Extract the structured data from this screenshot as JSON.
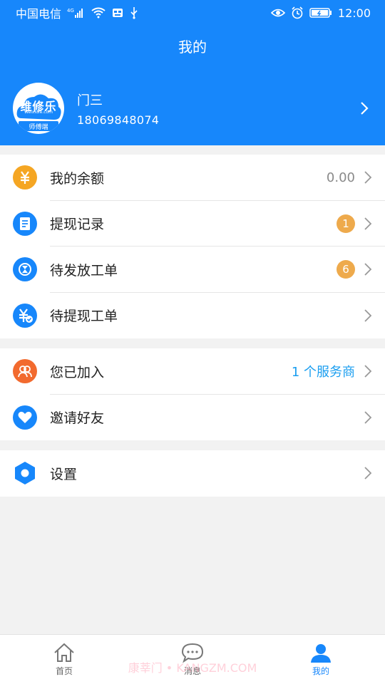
{
  "status_bar": {
    "carrier": "中国电信",
    "network": "4G",
    "time": "12:00"
  },
  "header": {
    "title": "我的"
  },
  "profile": {
    "name": "门三",
    "phone": "18069848074",
    "avatar_brand": "维修乐",
    "avatar_url": "Weixiule.com",
    "avatar_badge": "师傅端"
  },
  "menu_group_1": [
    {
      "label": "我的余额",
      "value": "0.00",
      "icon": "yen-icon",
      "color": "#f5a623"
    },
    {
      "label": "提现记录",
      "badge": "1",
      "icon": "document-icon",
      "color": "#1787fb"
    },
    {
      "label": "待发放工单",
      "badge": "6",
      "icon": "hourglass-icon",
      "color": "#1787fb"
    },
    {
      "label": "待提现工单",
      "icon": "yen-check-icon",
      "color": "#1787fb"
    }
  ],
  "menu_group_2": [
    {
      "label": "您已加入",
      "value": "1 个服务商",
      "icon": "people-icon",
      "color": "#f26a2e"
    },
    {
      "label": "邀请好友",
      "icon": "heart-icon",
      "color": "#1787fb"
    }
  ],
  "menu_group_3": [
    {
      "label": "设置",
      "icon": "hexagon-settings-icon",
      "color": "#1787fb"
    }
  ],
  "tabbar": [
    {
      "label": "首页",
      "icon": "home-icon",
      "active": false
    },
    {
      "label": "消息",
      "icon": "chat-icon",
      "active": false
    },
    {
      "label": "我的",
      "icon": "user-icon",
      "active": true
    }
  ],
  "watermark": "康莘门 • KANGZM.COM"
}
